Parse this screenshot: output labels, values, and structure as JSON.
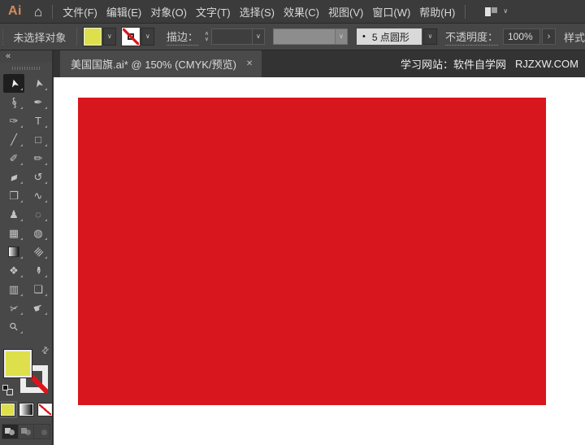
{
  "app": {
    "logo_text": "Ai",
    "home_icon": "⌂",
    "menus": [
      "文件(F)",
      "编辑(E)",
      "对象(O)",
      "文字(T)",
      "选择(S)",
      "效果(C)",
      "视图(V)",
      "窗口(W)",
      "帮助(H)"
    ],
    "workspace_chevron": "∨"
  },
  "control_bar": {
    "status_text": "未选择对象",
    "fill_color": "#dde04a",
    "stroke_label": "描边：",
    "stepper_up": "∧",
    "stepper_down": "∨",
    "chevron": "∨",
    "brush_bullet": "•",
    "brush_definition": "5 点圆形",
    "opacity_label": "不透明度：",
    "opacity_value": "100%",
    "opacity_more": "›",
    "style_label": "样式"
  },
  "tab_bar": {
    "collapse_icon": "«",
    "tab_title": "美国国旗.ai* @ 150% (CMYK/预览)",
    "close_icon": "✕",
    "right_text": "学习网站：软件自学网",
    "right_site": "RJZXW.COM"
  },
  "toolbar": {
    "tools": [
      {
        "name": "selection-tool",
        "glyph": "➤",
        "rot": "rot-cursor",
        "selected": true
      },
      {
        "name": "direct-selection-tool",
        "glyph": "➤",
        "rot": "rot-cursor"
      },
      {
        "name": "lasso-tool",
        "glyph": "∮",
        "rot": "rot-20n"
      },
      {
        "name": "pen-tool",
        "glyph": "✒"
      },
      {
        "name": "curvature-tool",
        "glyph": "✑"
      },
      {
        "name": "type-tool",
        "glyph": "T"
      },
      {
        "name": "line-segment-tool",
        "glyph": "╱"
      },
      {
        "name": "rectangle-tool",
        "glyph": "□"
      },
      {
        "name": "paintbrush-tool",
        "glyph": "✐"
      },
      {
        "name": "pencil-tool",
        "glyph": "✏"
      },
      {
        "name": "eraser-tool",
        "glyph": "▰",
        "rot": "rot-20n"
      },
      {
        "name": "rotate-tool",
        "glyph": "↺"
      },
      {
        "name": "scale-tool",
        "glyph": "❐"
      },
      {
        "name": "width-tool",
        "glyph": "∿"
      },
      {
        "name": "puppet-warp-tool",
        "glyph": "♟"
      },
      {
        "name": "free-transform-tool",
        "glyph": "◌"
      },
      {
        "name": "perspective-grid-tool",
        "glyph": "▦"
      },
      {
        "name": "mesh-tool",
        "glyph": "◍"
      },
      {
        "name": "gradient-tool",
        "gradient": true
      },
      {
        "name": "measure-tool",
        "glyph": "≣",
        "rot": "rot-45n"
      },
      {
        "name": "blend-tool",
        "glyph": "❖"
      },
      {
        "name": "eyedropper-tool",
        "glyph": "✒",
        "rot": "rot-90"
      },
      {
        "name": "column-graph-tool",
        "glyph": "▥"
      },
      {
        "name": "artboard-tool",
        "glyph": "❏"
      },
      {
        "name": "slice-tool",
        "glyph": "✁",
        "rot": "rot-30n"
      },
      {
        "name": "hand-tool",
        "glyph": "☛",
        "rot": "rot-20n"
      },
      {
        "name": "zoom-tool",
        "glyph": "⚲",
        "rot": "rot-45n"
      }
    ],
    "swap_icon": "⇄",
    "modes": [
      {
        "name": "draw-normal-mode",
        "selected": true
      },
      {
        "name": "draw-behind-mode",
        "cls": "dim"
      },
      {
        "name": "draw-inside-mode",
        "cls": "dimmest"
      }
    ]
  },
  "artwork": {
    "rect_color": "#d7161d",
    "canvas_color": "#ffffff"
  }
}
